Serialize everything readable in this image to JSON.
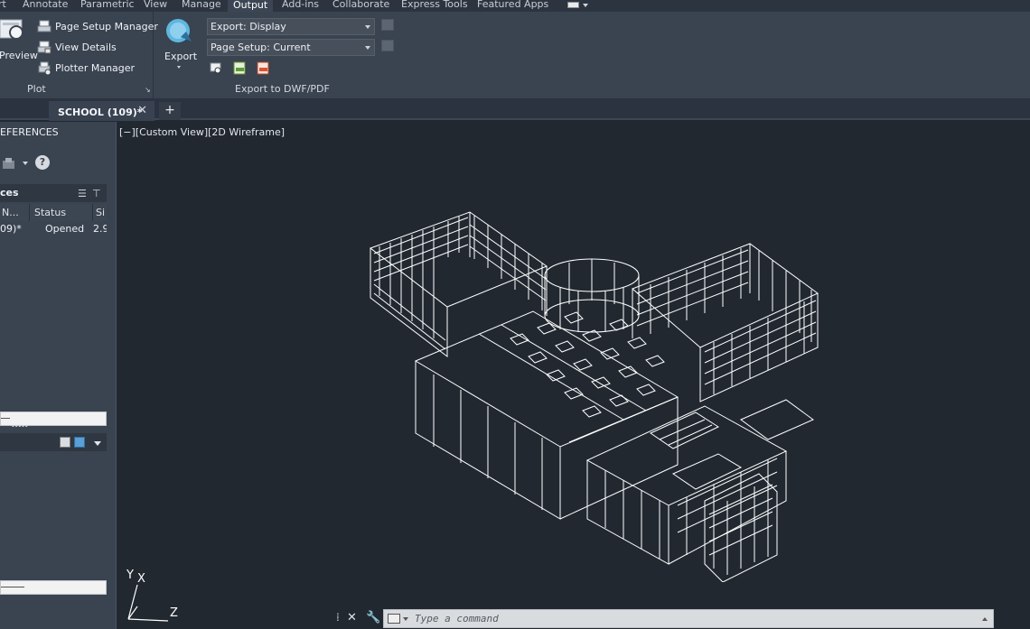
{
  "ribbon_tabs": [
    "rt",
    "Annotate",
    "Parametric",
    "View",
    "Manage",
    "Output",
    "Add-ins",
    "Collaborate",
    "Express Tools",
    "Featured Apps"
  ],
  "active_tab": "Output",
  "plot_panel": {
    "preview_label": "Preview",
    "page_setup_manager": "Page Setup Manager",
    "view_details": "View Details",
    "plotter_manager": "Plotter Manager",
    "title": "Plot"
  },
  "export_panel": {
    "export_label": "Export",
    "export_dropdown": "Export: Display",
    "page_setup_dropdown": "Page Setup: Current",
    "title": "Export to DWF/PDF"
  },
  "file_tab": {
    "name": "SCHOOL (109)*",
    "close": "✕",
    "new": "+"
  },
  "palette": {
    "title": "EFERENCES",
    "section_title": "ces",
    "columns": [
      "N...",
      "Status",
      "Si"
    ],
    "rows": [
      {
        "name": "09)*",
        "status": "Opened",
        "size": "2.9"
      }
    ],
    "grip": "•••••",
    "help": "?"
  },
  "viewport": {
    "label": "[−][Custom View][2D Wireframe]",
    "ucs_y": "Y",
    "ucs_x": "X",
    "ucs_z": "Z"
  },
  "command": {
    "placeholder": "Type a command",
    "close": "✕"
  },
  "colors": {
    "background": "#212830",
    "ribbon": "#3a4350",
    "wireframe": "#ffffff"
  }
}
